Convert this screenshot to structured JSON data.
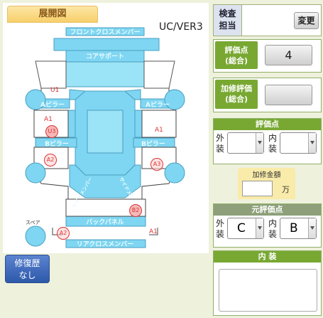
{
  "header": {
    "tab_title": "展開図",
    "version": "UC/VER3"
  },
  "diagram": {
    "parts": {
      "front_cross_member": "フロントクロスメンバー",
      "core_support": "コアサポート",
      "a_pillar_left": "Aピラー",
      "a_pillar_right": "Aピラー",
      "b_pillar_left": "Bピラー",
      "b_pillar_right": "Bピラー",
      "back_panel": "バックパネル",
      "rear_cross_member": "リアクロスメンバー",
      "side_left": "サイドメンバー",
      "side_right": "サイドメンバー",
      "spare": "スペア"
    },
    "marks": {
      "u1": "U1",
      "a1_left": "A1",
      "u3": "U3",
      "a2_left": "A2",
      "a1_right": "A1",
      "a3": "A3",
      "b2": "B2",
      "a2_bottom": "A2",
      "a1_bottom": "A1"
    }
  },
  "history_button": {
    "line1": "修復歴",
    "line2": "なし"
  },
  "inspector": {
    "label_line1": "検査",
    "label_line2": "担当",
    "change_button": "変更"
  },
  "score_total": {
    "label_line1": "評価点",
    "label_line2": "(総合)",
    "value": "4"
  },
  "repair_score": {
    "label_line1": "加修評価",
    "label_line2": "(総合)",
    "value": ""
  },
  "score": {
    "title": "評価点",
    "exterior_label": "外装",
    "interior_label": "内装",
    "exterior_value": "",
    "interior_value": ""
  },
  "repair_amount": {
    "title": "加修金額",
    "unit": "万",
    "value": ""
  },
  "original_score": {
    "title": "元評価点",
    "exterior_label": "外装",
    "interior_label": "内装",
    "exterior_value": "C",
    "interior_value": "B"
  },
  "interior": {
    "title": "内 装",
    "text": ""
  }
}
